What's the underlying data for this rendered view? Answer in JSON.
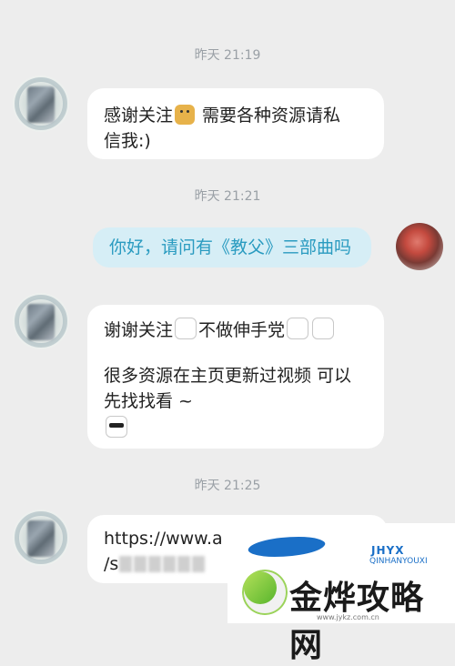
{
  "timestamps": [
    "昨天 21:19",
    "昨天 21:21",
    "昨天 21:25"
  ],
  "messages": {
    "m1": {
      "line1": "感谢关注",
      "line1b": " 需要各种资源请私",
      "line2": "信我:)"
    },
    "m2": {
      "text": "你好，请问有《教父》三部曲吗"
    },
    "m3": {
      "line1": "谢谢关注",
      "line1b": "不做伸手党",
      "line2": "很多资源在主页更新过视频 可以",
      "line3": "先找找看 ~"
    },
    "m4": {
      "line1": "https://www.a",
      "line2": "/s"
    }
  },
  "icons": {
    "dog": "dog-emoji-icon",
    "cat": "cat-emoji-icon",
    "cool": "sunglasses-cat-icon"
  },
  "brand": {
    "small": "JHYX",
    "small_sub": "QINHANYOUXI",
    "big": "金烨攻略网",
    "url": "www.jykz.com.cn"
  },
  "colors": {
    "bg": "#ededed",
    "out_bubble": "#d6eef6",
    "out_text": "#2a9bc0",
    "brand_blue": "#1a6fc7"
  }
}
